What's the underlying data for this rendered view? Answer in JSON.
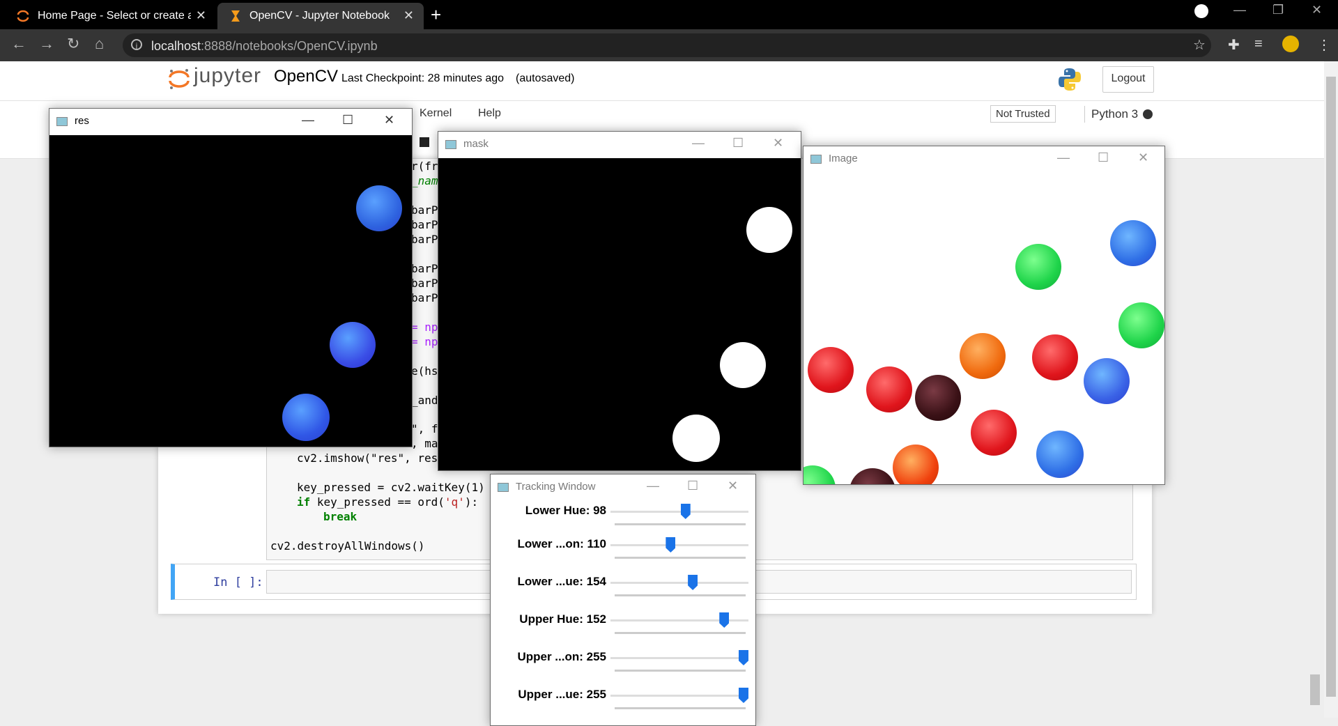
{
  "browser": {
    "tabs": [
      {
        "title": "Home Page - Select or create a n",
        "active": false,
        "icon": "jupyter-spinner-icon"
      },
      {
        "title": "OpenCV - Jupyter Notebook",
        "active": true,
        "icon": "hourglass-icon"
      }
    ],
    "new_tab": "+",
    "url_host": "localhost",
    "url_rest": ":8888/notebooks/OpenCV.ipynb"
  },
  "jupyter": {
    "logo_text": "jupyter",
    "notebook_name": "OpenCV",
    "checkpoint": "Last Checkpoint: 28 minutes ago",
    "autosaved": "(autosaved)",
    "logout": "Logout",
    "menu": [
      "Kernel",
      "Help"
    ],
    "trust": "Not Trusted",
    "kernel": "Python 3",
    "prompt": "In [ ]:"
  },
  "code": {
    "partial": [
      "r(fr",
      "_nam",
      "barP",
      "barP",
      "barP",
      "barP",
      "barP",
      "barP",
      "= np",
      "= np",
      "e(hs",
      "_and",
      "\", f"
    ],
    "line_imshow_mask_tail": ", ma",
    "line_imshow_res": "cv2.imshow(\"res\", res",
    "line_waitkey": "key_pressed = cv2.waitKey(1)",
    "line_if_kw": "if",
    "line_if_rest": " key_pressed == ord(",
    "line_if_str": "'q'",
    "line_if_end": "):",
    "line_break": "break",
    "line_destroy": "cv2.destroyAllWindows()"
  },
  "windows": {
    "res": {
      "title": "res"
    },
    "mask": {
      "title": "mask"
    },
    "image": {
      "title": "Image"
    },
    "tracking": {
      "title": "Tracking Window",
      "sliders": [
        {
          "label": "Lower Hue: 98",
          "value": 98,
          "max": 179
        },
        {
          "label": "Lower ...on: 110",
          "value": 110,
          "max": 255
        },
        {
          "label": "Lower ...ue: 154",
          "value": 154,
          "max": 255
        },
        {
          "label": "Upper Hue: 152",
          "value": 152,
          "max": 179
        },
        {
          "label": "Upper ...on: 255",
          "value": 255,
          "max": 255
        },
        {
          "label": "Upper ...ue: 255",
          "value": 255,
          "max": 255
        }
      ]
    }
  },
  "colors": {
    "blue_ball": "#3d7be8",
    "green_ball": "#22d64a",
    "red_ball": "#e0151c",
    "orange_ball": "#f06a0e",
    "brown_ball": "#3a1116",
    "slider_thumb": "#1a73e8",
    "kernel_idle": "#333333"
  }
}
